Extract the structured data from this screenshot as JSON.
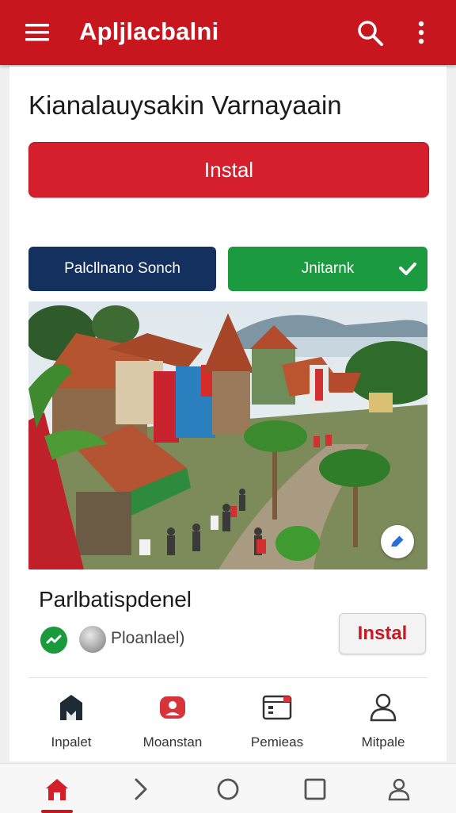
{
  "app_bar": {
    "title": "Apljlacbalni",
    "background": "#c8161e",
    "icons": [
      "menu-icon",
      "search-icon",
      "more-vert-icon"
    ]
  },
  "main": {
    "heading": "Kianalauysakin Varnayaain",
    "install_label": "Instal",
    "buttons": {
      "primary_label": "Palcllnano Sonch",
      "secondary_label": "Jnitarnk",
      "secondary_icon": "check-icon"
    },
    "photo_icon": "edit-icon"
  },
  "app_item": {
    "name": "Parlbatispdenel",
    "meta": "Ploanlael)",
    "install_label": "Instal"
  },
  "categories": [
    {
      "label": "Inpalet",
      "icon": "store-icon"
    },
    {
      "label": "Moanstan",
      "icon": "game-icon"
    },
    {
      "label": "Pemieas",
      "icon": "media-icon"
    },
    {
      "label": "Mitpale",
      "icon": "person-icon"
    }
  ],
  "nav": {
    "items": [
      "home-icon",
      "forward-icon",
      "circle-icon",
      "square-icon",
      "profile-icon"
    ],
    "active": "home-icon"
  },
  "colors": {
    "accent": "#c8161e",
    "navy": "#14305e",
    "green": "#1c9a3f"
  }
}
